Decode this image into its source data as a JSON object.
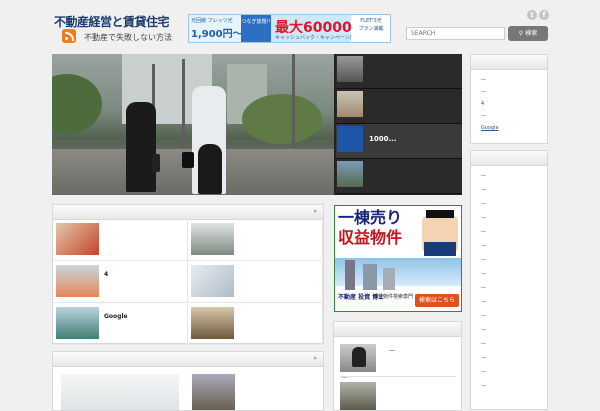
{
  "header": {
    "site_title": "不動産経営と賃貸住宅",
    "site_subtitle": "不動産で失敗しない方法",
    "banner": {
      "small": "光回線 フレッツ光",
      "price_small": "1,900円〜",
      "middle": "つなぎ放題!!",
      "amount": "最大60000円",
      "campaign": "キャッシュバック・キャンペーン実施中!!",
      "brand": "FLET'S光",
      "plan": "プラン満載"
    },
    "social": {
      "twitter": "t",
      "facebook": "f"
    },
    "search": {
      "placeholder": "SEARCH",
      "button_label": "検索"
    }
  },
  "slider": {
    "thumbnails": [
      {
        "label": ""
      },
      {
        "label": ""
      },
      {
        "label": "1000..."
      },
      {
        "label": ""
      }
    ]
  },
  "panels": [
    {
      "title": "",
      "arrow": "»",
      "items": [
        {
          "label": ""
        },
        {
          "label": ""
        },
        {
          "label": "4"
        },
        {
          "label": ""
        },
        {
          "label": "Google"
        },
        {
          "label": ""
        }
      ]
    },
    {
      "title": "",
      "arrow": "»"
    }
  ],
  "ad": {
    "line1": "一棟売り",
    "line2": "収益物件",
    "logo": "不動産 投資 博士",
    "desc": "収益物件検索専門 ポータルサイト",
    "button": "検索はこちら"
  },
  "widget3": {
    "entry_title": "—",
    "bullet": "—"
  },
  "sidebar": {
    "box1_items": [
      {
        "text": "—",
        "link": false
      },
      {
        "text": "—",
        "link": false
      },
      {
        "text": "4",
        "link": false
      },
      {
        "text": "—",
        "link": false
      },
      {
        "text": "Google",
        "link": true
      }
    ],
    "box2_items": [
      "—",
      "—",
      "—",
      "—",
      "—",
      "—",
      "—",
      "—",
      "—",
      "—",
      "—",
      "—",
      "—",
      "—",
      "—",
      "—"
    ]
  }
}
